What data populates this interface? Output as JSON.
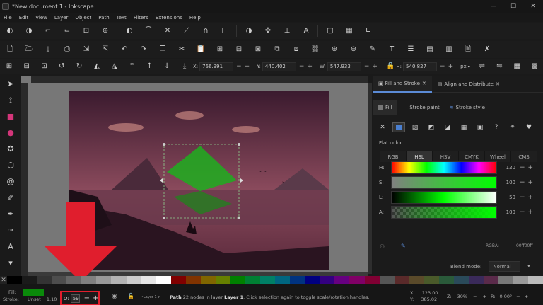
{
  "window": {
    "title": "*New document 1 - Inkscape",
    "controls": [
      "minimize-icon",
      "maximize-icon",
      "close-icon"
    ]
  },
  "menu": [
    "File",
    "Edit",
    "View",
    "Layer",
    "Object",
    "Path",
    "Text",
    "Filters",
    "Extensions",
    "Help"
  ],
  "toolbar": {
    "x_label": "X:",
    "x_value": "766.991",
    "y_label": "Y:",
    "y_value": "440.402",
    "w_label": "W:",
    "w_value": "547.933",
    "h_label": "H:",
    "h_value": "540.827",
    "unit": "px"
  },
  "dock": {
    "tabs": [
      {
        "label": "Fill and Stroke",
        "icon": "brush-icon"
      },
      {
        "label": "Align and Distribute",
        "icon": "align-icon"
      }
    ],
    "subtabs": [
      {
        "label": "Fill",
        "icon": "fill-swatch-icon"
      },
      {
        "label": "Stroke paint",
        "icon": "stroke-paint-icon"
      },
      {
        "label": "Stroke style",
        "icon": "stroke-style-icon"
      }
    ],
    "paint_types": [
      "none-icon",
      "flat-color-icon",
      "linear-gradient-icon",
      "radial-gradient-icon",
      "mesh-gradient-icon",
      "pattern-icon",
      "swatch-icon",
      "unset-icon",
      "fill-rule-evenodd-icon",
      "fill-rule-nonzero-icon"
    ],
    "flat_color_label": "Flat color",
    "color_modes": [
      "RGB",
      "HSL",
      "HSV",
      "CMYK",
      "Wheel",
      "CMS"
    ],
    "selected_mode": "HSL",
    "sliders": [
      {
        "label": "H:",
        "value": "120"
      },
      {
        "label": "S:",
        "value": "100"
      },
      {
        "label": "L:",
        "value": "50"
      },
      {
        "label": "A:",
        "value": "100"
      }
    ],
    "rgba_label": "RGBA:",
    "rgba_value": "00ff00ff",
    "blend_label": "Blend mode:",
    "blend_value": "Normal"
  },
  "status": {
    "fill_label": "Fill:",
    "stroke_label": "Stroke:",
    "stroke_value": "Unset",
    "stroke_width": "1.10",
    "opacity_label": "O:",
    "opacity_value": "59",
    "layer_name": "Layer 1",
    "message_bold_1": "Path",
    "message_1": " 22 nodes in layer ",
    "message_bold_2": "Layer 1",
    "message_2": ". Click selection again to toggle scale/rotation handles.",
    "x_label": "X:",
    "x_value": "123.00",
    "y_label": "Y:",
    "y_value": "385.02",
    "z_label": "Z:",
    "zoom_value": "30%",
    "r_label": "R:",
    "rotation_value": "0.00°"
  },
  "colors": {
    "fill_green": "#0a8a0a",
    "selection_green": "#1fae1f",
    "annotation_red": "#e01e2d",
    "sky_top": "#3a1a2e",
    "sky_bottom": "#9a5060"
  }
}
